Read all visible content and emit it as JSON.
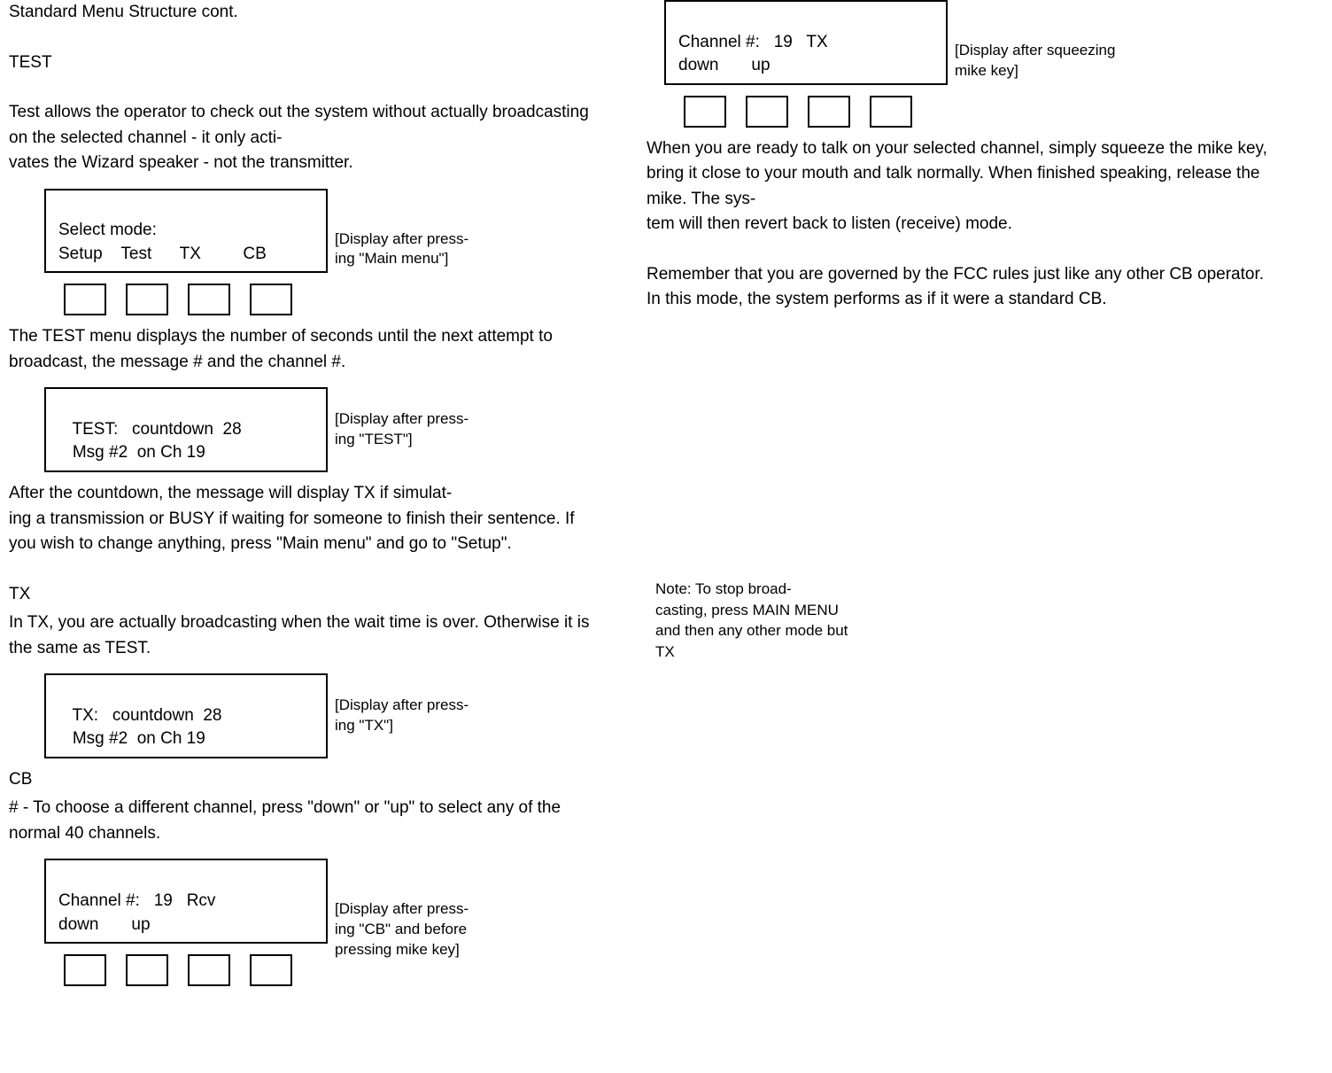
{
  "left": {
    "title": "Standard Menu Structure cont.",
    "test_heading": "TEST",
    "test_para": "Test allows the operator to check out the system without actually broadcasting on the selected channel - it only acti-\nvates the Wizard speaker - not the transmitter.",
    "lcd1": {
      "line1": "Select mode:",
      "line2": "Setup    Test      TX         CB",
      "caption": "[Display after press-\ning \"Main menu\"]"
    },
    "test_para2": "The TEST menu displays the number of seconds until the next attempt to broadcast, the message # and the channel #.",
    "lcd2": {
      "line1": "   TEST:   countdown  28",
      "line2": "   Msg #2  on Ch 19",
      "caption": "[Display after press-\ning \"TEST\"]"
    },
    "test_para3": "After the countdown, the message will display TX if simulat-\ning a transmission or BUSY if waiting for someone to finish their sentence. If you wish to change anything, press \"Main menu\" and go to \"Setup\".",
    "tx_heading": "TX",
    "tx_para": "In TX, you are actually broadcasting when the wait time is over.  Otherwise it is the same as TEST.",
    "lcd3": {
      "line1": "   TX:   countdown  28",
      "line2": "   Msg #2  on Ch 19",
      "caption": "[Display after press-\ning \"TX\"]"
    },
    "cb_heading": "CB",
    "cb_para": " # - To choose a different channel, press \"down\" or \"up\" to select any of the normal 40 channels.",
    "lcd4": {
      "line1": "Channel #:   19   Rcv",
      "line2": "down       up",
      "caption": "[Display after press-\ning \"CB\" and before pressing mike key]"
    }
  },
  "right": {
    "lcd5": {
      "line1": "Channel #:   19   TX",
      "line2": "down       up",
      "caption": "[Display after squeezing  mike key]"
    },
    "para1": "When you are ready to talk on your selected channel, simply squeeze the mike key, bring it close to your mouth and talk normally.  When finished speaking, release the mike.  The sys-\ntem will then revert back to listen (receive) mode.",
    "para2": "Remember that you are governed by the FCC rules just like any other CB operator.  In this mode, the system performs as if it were a standard CB.",
    "note": "Note: To stop broad-\ncasting, press MAIN MENU and then any other mode but TX"
  }
}
